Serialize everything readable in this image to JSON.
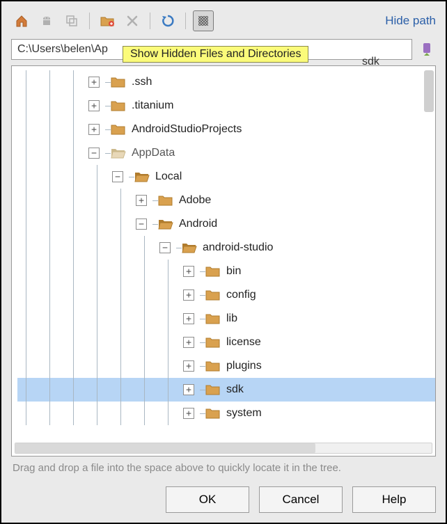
{
  "toolbar": {
    "home_icon": "home",
    "android_icon": "android",
    "clone_icon": "clone",
    "newfolder_icon": "new-folder",
    "delete_icon": "delete",
    "refresh_icon": "refresh",
    "showhidden_icon": "show-hidden",
    "hide_path_label": "Hide path"
  },
  "tooltip": "Show Hidden Files and Directories",
  "path": {
    "value": "C:\\Users\\belen\\Ap",
    "suffix": "sdk"
  },
  "tree": {
    "nodes": [
      {
        "depth": 3,
        "expander": "+",
        "label": ".ssh",
        "dim": false
      },
      {
        "depth": 3,
        "expander": "+",
        "label": ".titanium",
        "dim": false
      },
      {
        "depth": 3,
        "expander": "+",
        "label": "AndroidStudioProjects",
        "dim": false
      },
      {
        "depth": 3,
        "expander": "-",
        "label": "AppData",
        "dim": true,
        "open": true
      },
      {
        "depth": 4,
        "expander": "-",
        "label": "Local",
        "dim": false
      },
      {
        "depth": 5,
        "expander": "+",
        "label": "Adobe",
        "dim": false
      },
      {
        "depth": 5,
        "expander": "-",
        "label": "Android",
        "dim": false
      },
      {
        "depth": 6,
        "expander": "-",
        "label": "android-studio",
        "dim": false
      },
      {
        "depth": 7,
        "expander": "+",
        "label": "bin",
        "dim": false
      },
      {
        "depth": 7,
        "expander": "+",
        "label": "config",
        "dim": false
      },
      {
        "depth": 7,
        "expander": "+",
        "label": "lib",
        "dim": false
      },
      {
        "depth": 7,
        "expander": "+",
        "label": "license",
        "dim": false
      },
      {
        "depth": 7,
        "expander": "+",
        "label": "plugins",
        "dim": false
      },
      {
        "depth": 7,
        "expander": "+",
        "label": "sdk",
        "dim": false,
        "selected": true
      },
      {
        "depth": 7,
        "expander": "+",
        "label": "system",
        "dim": false
      }
    ]
  },
  "hint": "Drag and drop a file into the space above to quickly locate it in the tree.",
  "buttons": {
    "ok": "OK",
    "cancel": "Cancel",
    "help": "Help"
  }
}
